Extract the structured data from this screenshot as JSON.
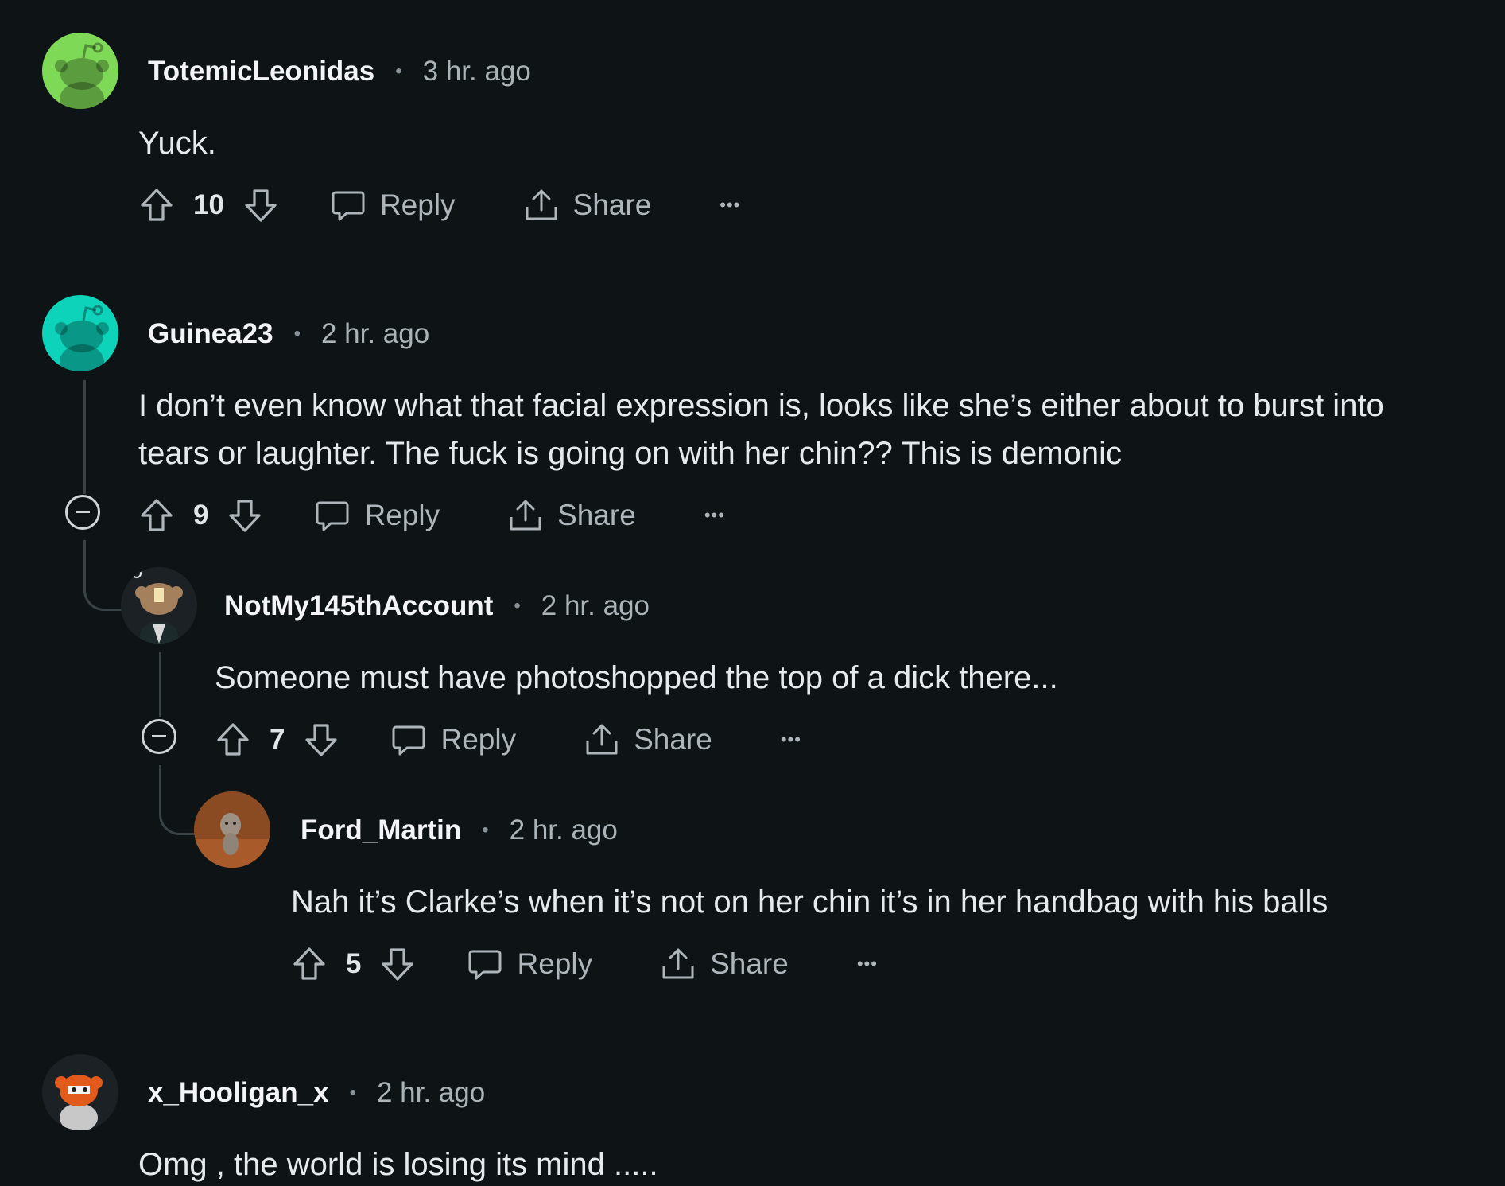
{
  "comments": [
    {
      "username": "TotemicLeonidas",
      "time": "3 hr. ago",
      "body": [
        "Yuck."
      ],
      "score": "10",
      "reply": "Reply",
      "share": "Share",
      "more": "•••",
      "avatar": "snoo-avatar-green"
    },
    {
      "username": "Guinea23",
      "time": "2 hr. ago",
      "body": [
        "I don’t even know what that facial expression is, looks like she’s either about to burst into",
        "tears or laughter. The fuck is going on with her chin?? This is demonic"
      ],
      "score": "9",
      "reply": "Reply",
      "share": "Share",
      "more": "•••",
      "avatar": "snoo-avatar-teal"
    },
    {
      "username": "NotMy145thAccount",
      "time": "2 hr. ago",
      "body": [
        "Someone must have photoshopped the top of a dick there..."
      ],
      "score": "7",
      "reply": "Reply",
      "share": "Share",
      "more": "•••",
      "avatar": "custom-snoo-avatar"
    },
    {
      "username": "Ford_Martin",
      "time": "2 hr. ago",
      "body": [
        "Nah it’s Clarke’s when it’s not on her chin it’s in her handbag with his balls"
      ],
      "score": "5",
      "reply": "Reply",
      "share": "Share",
      "more": "•••",
      "avatar": "dog-photo-avatar"
    },
    {
      "username": "x_Hooligan_x",
      "time": "2 hr. ago",
      "body": [
        "Omg , the world is losing its mind ....."
      ],
      "avatar": "custom-snoo-avatar-orange"
    }
  ],
  "separator": "•",
  "colors": {
    "background": "#0e1416",
    "text": "#e2e6e8",
    "meta": "#aab3b8",
    "thread_line": "#384247",
    "avatar_green": "#7ed957",
    "avatar_teal": "#0dd3bb"
  }
}
